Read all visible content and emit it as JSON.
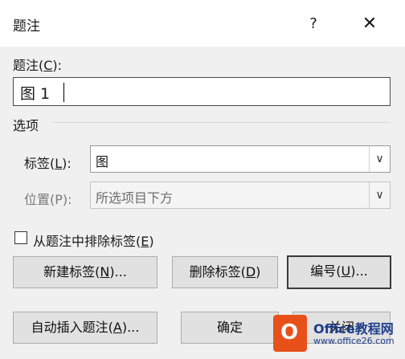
{
  "window": {
    "title": "题注",
    "help_label": "?",
    "close_label": "✕"
  },
  "caption": {
    "label": "题注(",
    "label_key": "C",
    "label_end": "):",
    "value": "图 1"
  },
  "options": {
    "section_label": "选项",
    "label_field": {
      "label": "标签(",
      "key": "L",
      "end": "):",
      "value": "图"
    },
    "position_field": {
      "label": "位置(P):",
      "value": "所选项目下方"
    },
    "exclude_label": {
      "label": "从题注中排除标签(",
      "key": "E",
      "end": ")",
      "checked": false
    }
  },
  "buttons": {
    "new_label": {
      "text": "新建标签(",
      "key": "N",
      "end": ")..."
    },
    "delete_label": {
      "text": "删除标签(",
      "key": "D",
      "end": ")"
    },
    "numbering": {
      "text": "编号(",
      "key": "U",
      "end": ")..."
    },
    "autocaption": {
      "text": "自动插入题注(",
      "key": "A",
      "end": ")..."
    },
    "ok": {
      "text": "确定"
    },
    "close": {
      "text": "关闭"
    }
  },
  "icons": {
    "dropdown": "chevron-down-icon",
    "office_logo": "office-logo-icon"
  },
  "watermark": {
    "title": "Office教程网",
    "url": "www.office26.com"
  },
  "colors": {
    "dialog_bg": "#f0f0f0",
    "button_bg": "#e1e1e1",
    "logo_orange": "#e8501a",
    "watermark_blue": "#1d3e8c"
  }
}
